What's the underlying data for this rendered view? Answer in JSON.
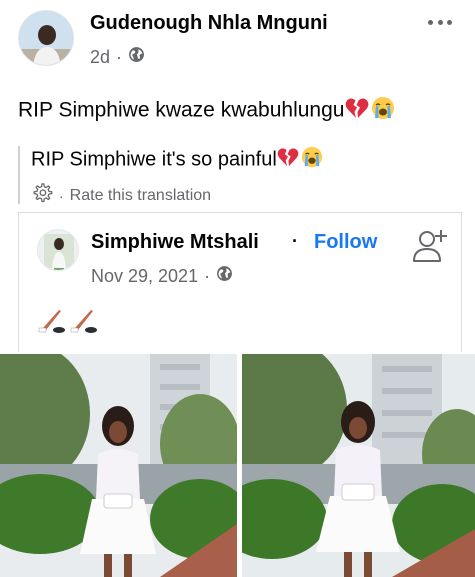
{
  "post": {
    "author": "Gudenough Nhla Mnguni",
    "time": "2d",
    "time_separator": "·",
    "privacy_icon": "globe-icon",
    "more_icon": "more-dots-icon",
    "text": "RIP Simphiwe kwaze kwabuhlungu",
    "emojis": [
      "broken-heart-emoji",
      "loudly-crying-face-emoji"
    ]
  },
  "translation": {
    "text": "RIP Simphiwe it's so painful",
    "emojis": [
      "broken-heart-emoji",
      "loudly-crying-face-emoji"
    ],
    "rate_icon": "gear-icon",
    "rate_separator": "·",
    "rate_label": "Rate this translation"
  },
  "shared_post": {
    "author": "Simphiwe Mtshali",
    "separator": "·",
    "follow_label": "Follow",
    "add_friend_icon": "add-friend-icon",
    "date": "Nov 29, 2021",
    "date_separator": "·",
    "privacy_icon": "globe-icon",
    "text_emojis": [
      "hockey-stick-emoji",
      "hockey-stick-emoji"
    ]
  },
  "photos": [
    {
      "name": "photo-woman-white-outfit-1"
    },
    {
      "name": "photo-woman-white-outfit-2"
    }
  ],
  "colors": {
    "link": "#1877f2",
    "text": "#050505",
    "secondary_text": "#65676b",
    "border": "#dadde1"
  }
}
